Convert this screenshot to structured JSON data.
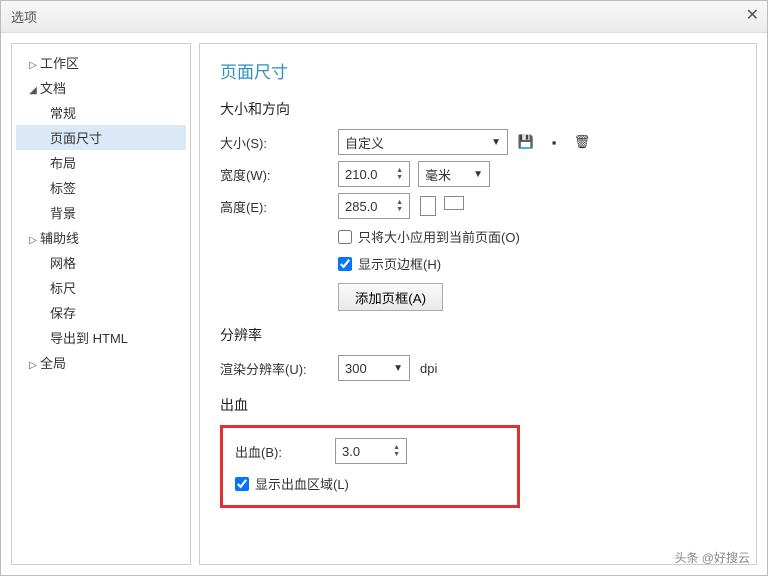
{
  "title": "选项",
  "tree": {
    "workspace": "工作区",
    "document": "文档",
    "general": "常规",
    "pagesize": "页面尺寸",
    "layout": "布局",
    "label": "标签",
    "background": "背景",
    "guides": "辅助线",
    "grid": "网格",
    "rulers": "标尺",
    "save": "保存",
    "export": "导出到 HTML",
    "global": "全局"
  },
  "panel": {
    "heading": "页面尺寸",
    "sizeSection": "大小和方向",
    "sizeLabel": "大小(S):",
    "sizeValue": "自定义",
    "widthLabel": "宽度(W):",
    "widthValue": "210.0",
    "unitValue": "毫米",
    "heightLabel": "高度(E):",
    "heightValue": "285.0",
    "applyCurrent": "只将大小应用到当前页面(O)",
    "showBorder": "显示页边框(H)",
    "addFrame": "添加页框(A)",
    "resolutionSection": "分辨率",
    "renderResLabel": "渲染分辨率(U):",
    "renderResValue": "300",
    "dpi": "dpi",
    "bleedSection": "出血",
    "bleedLabel": "出血(B):",
    "bleedValue": "3.0",
    "showBleed": "显示出血区域(L)"
  },
  "footer": "头条 @好搜云"
}
